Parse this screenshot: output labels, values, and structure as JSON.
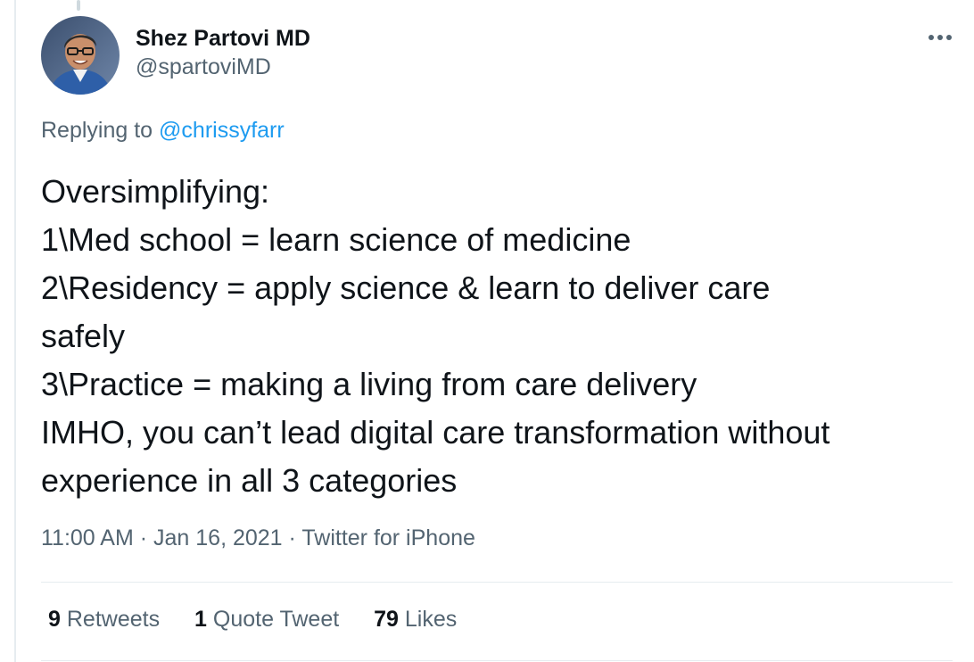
{
  "author": {
    "display_name": "Shez Partovi MD",
    "handle": "@spartoviMD"
  },
  "reply": {
    "prefix": "Replying to",
    "mention": "@chrissyfarr"
  },
  "tweet_lines": [
    "Oversimplifying:",
    "1\\Med school = learn science of medicine",
    "2\\Residency = apply science & learn to deliver care",
    "safely",
    "3\\Practice = making a living from care delivery",
    "IMHO, you can’t lead digital care transformation without",
    "experience in all 3 categories"
  ],
  "meta": {
    "time": "11:00 AM",
    "separator": "·",
    "date": "Jan 16, 2021",
    "source": "Twitter for iPhone"
  },
  "stats": {
    "retweets": {
      "count": "9",
      "label": "Retweets"
    },
    "quotes": {
      "count": "1",
      "label": "Quote Tweet"
    },
    "likes": {
      "count": "79",
      "label": "Likes"
    }
  },
  "icons": {
    "more": "more-horizontal-icon"
  },
  "colors": {
    "text_primary": "#0f1419",
    "text_secondary": "#536471",
    "link": "#1d9bf0",
    "divider": "#e6ecf0"
  }
}
